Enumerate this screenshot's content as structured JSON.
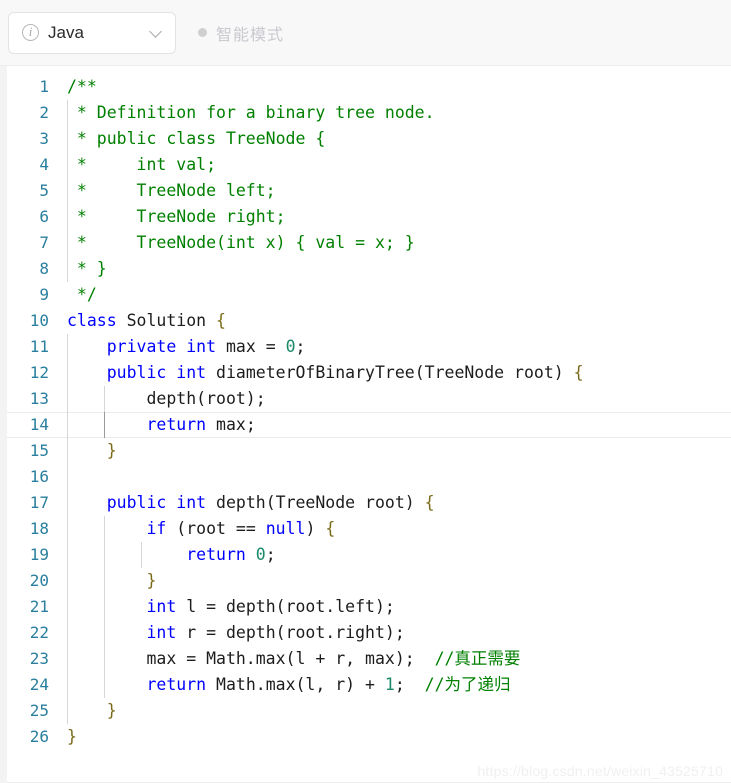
{
  "header": {
    "language_selector": {
      "info_icon": "info-circle-icon",
      "value": "Java",
      "chevron_icon": "chevron-down-icon"
    },
    "mode": {
      "dot_icon": "status-dot-icon",
      "label": "智能模式"
    }
  },
  "editor": {
    "active_line": 14,
    "colors": {
      "comment": "#008000",
      "keyword": "#0000ff",
      "number": "#1a8a6a",
      "brace": "#7a6a18",
      "line_number": "#2a7f9e",
      "plain": "#1c1c1c"
    },
    "lines": [
      {
        "n": "1",
        "guides": [],
        "tokens": [
          {
            "t": "/**",
            "c": "cmt"
          }
        ]
      },
      {
        "n": "2",
        "guides": [
          "g1"
        ],
        "tokens": [
          {
            "t": " * Definition for a binary tree node.",
            "c": "cmt"
          }
        ]
      },
      {
        "n": "3",
        "guides": [
          "g1"
        ],
        "tokens": [
          {
            "t": " * public class TreeNode {",
            "c": "cmt"
          }
        ]
      },
      {
        "n": "4",
        "guides": [
          "g1"
        ],
        "tokens": [
          {
            "t": " *     int val;",
            "c": "cmt"
          }
        ]
      },
      {
        "n": "5",
        "guides": [
          "g1"
        ],
        "tokens": [
          {
            "t": " *     TreeNode left;",
            "c": "cmt"
          }
        ]
      },
      {
        "n": "6",
        "guides": [
          "g1"
        ],
        "tokens": [
          {
            "t": " *     TreeNode right;",
            "c": "cmt"
          }
        ]
      },
      {
        "n": "7",
        "guides": [
          "g1"
        ],
        "tokens": [
          {
            "t": " *     TreeNode(int x) { val = x; }",
            "c": "cmt"
          }
        ]
      },
      {
        "n": "8",
        "guides": [
          "g1"
        ],
        "tokens": [
          {
            "t": " * }",
            "c": "cmt"
          }
        ]
      },
      {
        "n": "9",
        "guides": [],
        "tokens": [
          {
            "t": " */",
            "c": "cmt"
          }
        ]
      },
      {
        "n": "10",
        "guides": [],
        "tokens": [
          {
            "t": "class",
            "c": "kw"
          },
          {
            "t": " Solution ",
            "c": "pl"
          },
          {
            "t": "{",
            "c": "brc"
          }
        ]
      },
      {
        "n": "11",
        "guides": [
          "g1"
        ],
        "tokens": [
          {
            "t": "    ",
            "c": "pl"
          },
          {
            "t": "private int",
            "c": "kw"
          },
          {
            "t": " max = ",
            "c": "pl"
          },
          {
            "t": "0",
            "c": "num"
          },
          {
            "t": ";",
            "c": "pl"
          }
        ]
      },
      {
        "n": "12",
        "guides": [
          "g1"
        ],
        "tokens": [
          {
            "t": "    ",
            "c": "pl"
          },
          {
            "t": "public int",
            "c": "kw"
          },
          {
            "t": " diameterOfBinaryTree(TreeNode root) ",
            "c": "pl"
          },
          {
            "t": "{",
            "c": "brc"
          }
        ]
      },
      {
        "n": "13",
        "guides": [
          "g1",
          "g2"
        ],
        "tokens": [
          {
            "t": "        depth(root);",
            "c": "pl"
          }
        ]
      },
      {
        "n": "14",
        "guides": [
          "g1",
          "g2d"
        ],
        "tokens": [
          {
            "t": "        ",
            "c": "pl"
          },
          {
            "t": "return",
            "c": "kw"
          },
          {
            "t": " max;",
            "c": "pl"
          }
        ]
      },
      {
        "n": "15",
        "guides": [
          "g1"
        ],
        "tokens": [
          {
            "t": "    ",
            "c": "pl"
          },
          {
            "t": "}",
            "c": "brc"
          }
        ]
      },
      {
        "n": "16",
        "guides": [
          "g1"
        ],
        "tokens": [
          {
            "t": "",
            "c": "pl"
          }
        ]
      },
      {
        "n": "17",
        "guides": [
          "g1"
        ],
        "tokens": [
          {
            "t": "    ",
            "c": "pl"
          },
          {
            "t": "public int",
            "c": "kw"
          },
          {
            "t": " depth(TreeNode root) ",
            "c": "pl"
          },
          {
            "t": "{",
            "c": "brc"
          }
        ]
      },
      {
        "n": "18",
        "guides": [
          "g1",
          "g2"
        ],
        "tokens": [
          {
            "t": "        ",
            "c": "pl"
          },
          {
            "t": "if",
            "c": "kw"
          },
          {
            "t": " (root == ",
            "c": "pl"
          },
          {
            "t": "null",
            "c": "kw"
          },
          {
            "t": ") ",
            "c": "pl"
          },
          {
            "t": "{",
            "c": "brc"
          }
        ]
      },
      {
        "n": "19",
        "guides": [
          "g1",
          "g2",
          "g3"
        ],
        "tokens": [
          {
            "t": "            ",
            "c": "pl"
          },
          {
            "t": "return",
            "c": "kw"
          },
          {
            "t": " ",
            "c": "pl"
          },
          {
            "t": "0",
            "c": "num"
          },
          {
            "t": ";",
            "c": "pl"
          }
        ]
      },
      {
        "n": "20",
        "guides": [
          "g1",
          "g2"
        ],
        "tokens": [
          {
            "t": "        ",
            "c": "pl"
          },
          {
            "t": "}",
            "c": "brc"
          }
        ]
      },
      {
        "n": "21",
        "guides": [
          "g1",
          "g2"
        ],
        "tokens": [
          {
            "t": "        ",
            "c": "pl"
          },
          {
            "t": "int",
            "c": "kw"
          },
          {
            "t": " l = depth(root.left);",
            "c": "pl"
          }
        ]
      },
      {
        "n": "22",
        "guides": [
          "g1",
          "g2"
        ],
        "tokens": [
          {
            "t": "        ",
            "c": "pl"
          },
          {
            "t": "int",
            "c": "kw"
          },
          {
            "t": " r = depth(root.right);",
            "c": "pl"
          }
        ]
      },
      {
        "n": "23",
        "guides": [
          "g1",
          "g2"
        ],
        "tokens": [
          {
            "t": "        max = Math.max(l + r, max);  ",
            "c": "pl"
          },
          {
            "t": "//真正需要",
            "c": "cmt"
          }
        ]
      },
      {
        "n": "24",
        "guides": [
          "g1",
          "g2"
        ],
        "tokens": [
          {
            "t": "        ",
            "c": "pl"
          },
          {
            "t": "return",
            "c": "kw"
          },
          {
            "t": " Math.max(l, r) + ",
            "c": "pl"
          },
          {
            "t": "1",
            "c": "num"
          },
          {
            "t": ";  ",
            "c": "pl"
          },
          {
            "t": "//为了递归",
            "c": "cmt"
          }
        ]
      },
      {
        "n": "25",
        "guides": [
          "g1"
        ],
        "tokens": [
          {
            "t": "    ",
            "c": "pl"
          },
          {
            "t": "}",
            "c": "brc"
          }
        ]
      },
      {
        "n": "26",
        "guides": [],
        "tokens": [
          {
            "t": "}",
            "c": "brc"
          }
        ]
      }
    ]
  },
  "watermark": {
    "text": "https://blog.csdn.net/weixin_43525710"
  }
}
